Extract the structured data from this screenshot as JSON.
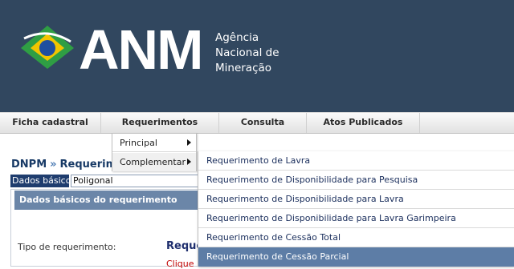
{
  "header": {
    "logo_text": "ANM",
    "logo_subtitle_lines": [
      "Agência",
      "Nacional de",
      "Mineração"
    ],
    "background_color": "#31475f"
  },
  "navbar": {
    "items": [
      {
        "label": "Ficha cadastral"
      },
      {
        "label": "Requerimentos"
      },
      {
        "label": "Consulta"
      },
      {
        "label": "Atos Publicados"
      }
    ]
  },
  "dropdown": {
    "items": [
      {
        "label": "Principal",
        "icon": "chevron-right-icon"
      },
      {
        "label": "Complementar",
        "icon": "chevron-right-icon"
      }
    ],
    "active_item": "Complementar"
  },
  "submenu": {
    "items": [
      {
        "label": "Requerimento de Lavra"
      },
      {
        "label": "Requerimento de Disponibilidade para Pesquisa"
      },
      {
        "label": "Requerimento de Disponibilidade para Lavra"
      },
      {
        "label": "Requerimento de Disponibilidade para Lavra Garimpeira"
      },
      {
        "label": "Requerimento de Cessão Total"
      },
      {
        "label": "Requerimento de Cessão Parcial"
      }
    ],
    "highlighted_item": "Requerimento de Cessão Parcial",
    "highlight_color": "#5d7da6"
  },
  "page": {
    "breadcrumb": {
      "root": "DNPM",
      "separator": "»",
      "current": "Requerim"
    },
    "tabs": [
      {
        "label": "Dados básicos",
        "active": true
      },
      {
        "label": "Poligonal",
        "active": false
      }
    ],
    "panel": {
      "title": "Dados básicos do requerimento",
      "field_label": "Tipo de requerimento:",
      "field_value": "Reque",
      "link_text": "Clique"
    }
  }
}
